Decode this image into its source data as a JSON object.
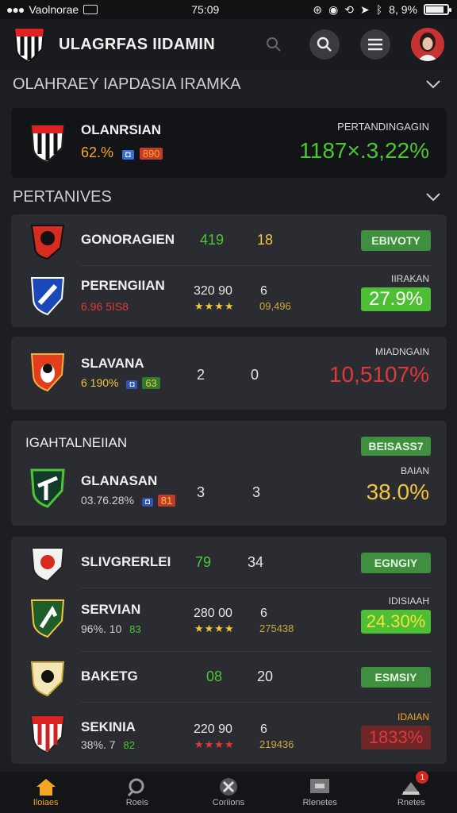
{
  "status_bar": {
    "carrier": "Vaolnorae",
    "time": "75:09",
    "battery_text": "8, 9%",
    "battery_level": 0.85
  },
  "app": {
    "title": "ULAGRFAS IIDAMIN"
  },
  "section1": {
    "title": "OLAHRAEY IAPDASIA IRAMKA"
  },
  "featured": {
    "team": "OLANRSIAN",
    "pct": "62.%",
    "badge": "890",
    "tag": "PERTANDINGAGIN",
    "big_value": "1187×.3,22%"
  },
  "section2": {
    "title": "PERTANIVES"
  },
  "group_a": {
    "row1": {
      "team": "GONORAGIEN",
      "score1": "419",
      "score2": "18",
      "pill": "EBIVOTY"
    },
    "row2": {
      "team": "PERENGIIAN",
      "sub": "6.96 5IS8",
      "val1": "320 90",
      "val2": "6",
      "stars": "★★★★",
      "sub2": "09,496",
      "tag": "IIRAKAN",
      "pct": "27.9%"
    }
  },
  "group_b": {
    "team": "SLAVANA",
    "score1": "2",
    "score2": "0",
    "sub": "6 190%",
    "badge": "63",
    "tag": "MIADNGAIN",
    "pct": "10,5107%"
  },
  "group_c": {
    "title": "IGAHTALNEIIAN",
    "pill": "BEISASS7",
    "team": "GLANASAN",
    "score1": "3",
    "score2": "3",
    "sub": "03.76.28%",
    "badge": "81",
    "tag": "BAIAN",
    "pct": "38.0%"
  },
  "group_d": {
    "row1": {
      "team": "SLIVGRERLEI",
      "score1": "79",
      "score2": "34",
      "pill": "EGNGIY"
    },
    "row2": {
      "team": "SERVIAN",
      "sub": "96%. 10",
      "badge": "83",
      "val1": "280 00",
      "val2": "6",
      "stars": "★★★★",
      "sub2": "275438",
      "tag": "IDISIAAH",
      "pct": "24.30%"
    },
    "row3": {
      "team": "BAKETG",
      "score1": "08",
      "score2": "20",
      "pill": "ESMSIY"
    },
    "row4": {
      "team": "SEKINIA",
      "sub": "38%. 7",
      "badge": "82",
      "val1": "220 90",
      "val2": "6",
      "stars": "★★★★",
      "sub2": "219436",
      "tag": "IDAIAN",
      "pct": "1833%"
    }
  },
  "nav": {
    "items": [
      {
        "label": "Iloiaes",
        "icon": "home-icon"
      },
      {
        "label": "Roeis",
        "icon": "search-icon"
      },
      {
        "label": "Coriions",
        "icon": "tools-icon"
      },
      {
        "label": "Rlenetes",
        "icon": "board-icon"
      },
      {
        "label": "Rnetes",
        "icon": "alert-icon"
      }
    ],
    "notification_count": "1"
  },
  "colors": {
    "green": "#4cc636",
    "red": "#e0393a",
    "yellow": "#f3c53c",
    "orange": "#f5a623",
    "pill_green": "#3f8f3f"
  }
}
